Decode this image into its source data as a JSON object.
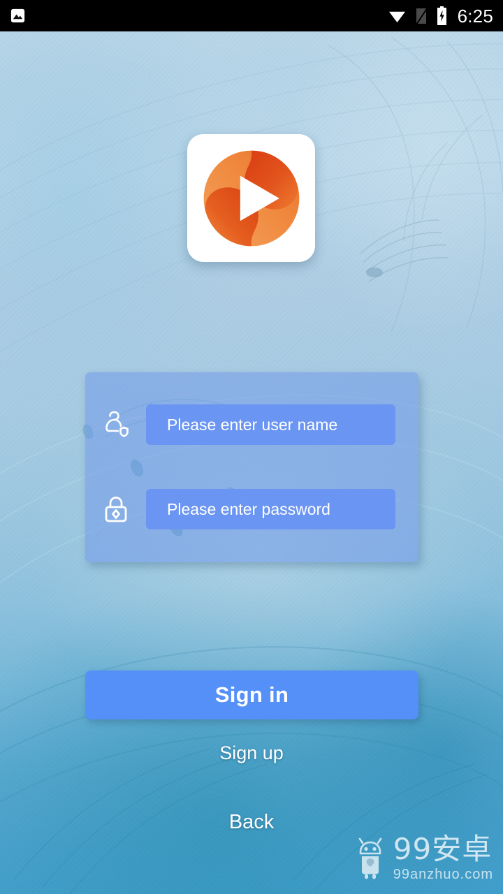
{
  "statusbar": {
    "screenshot_icon": "photo-icon",
    "wifi_icon": "wifi-icon",
    "sim_icon": "no-sim-icon",
    "battery_icon": "battery-charging-icon",
    "time": "6:25"
  },
  "branding": {
    "logo_icon": "play-media-logo-icon"
  },
  "form": {
    "username": {
      "icon": "user-account-icon",
      "value": "",
      "placeholder": "Please enter user name"
    },
    "password": {
      "icon": "lock-icon",
      "value": "",
      "placeholder": "Please enter password"
    }
  },
  "actions": {
    "sign_in_label": "Sign in",
    "sign_up_label": "Sign up",
    "back_label": "Back"
  },
  "watermark": {
    "robot_icon": "android-robot-icon",
    "title": "99安卓",
    "url": "99anzhuo.com"
  },
  "colors": {
    "input_fill": "#6b95f2",
    "panel_fill": "#7098ea",
    "primary_button": "#5590f8",
    "logo_orange_light": "#f5954a",
    "logo_orange_deep": "#dd4418",
    "text_on_dark": "#ffffff",
    "statusbar_bg": "#000000"
  }
}
